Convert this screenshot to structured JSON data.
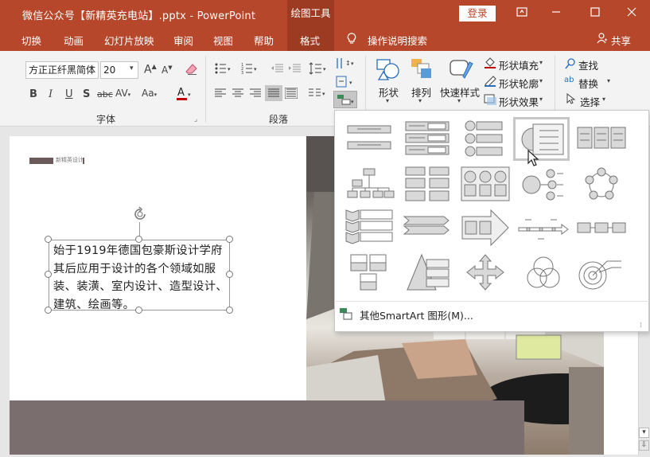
{
  "titlebar": {
    "document_title": "微信公众号【新精英充电站】.pptx  -  PowerPoint",
    "contextual_tab": "绘图工具",
    "login_label": "登录",
    "colors": {
      "accent": "#b7472a",
      "accent_dark": "#9c3b22"
    }
  },
  "tabs": [
    {
      "label": "切换"
    },
    {
      "label": "动画"
    },
    {
      "label": "幻灯片放映"
    },
    {
      "label": "审阅"
    },
    {
      "label": "视图"
    },
    {
      "label": "帮助"
    },
    {
      "label": "格式"
    }
  ],
  "tell_me": "操作说明搜索",
  "share_label": "共享",
  "ribbon": {
    "font_group_label": "字体",
    "paragraph_group_label": "段落",
    "font_name": "方正正纤黑简体",
    "font_size": "20",
    "shape_label": "形状",
    "arrange_label": "排列",
    "quick_style_label": "快速样式",
    "shape_fill": "形状填充",
    "shape_outline": "形状轮廓",
    "shape_effects": "形状效果",
    "find": "查找",
    "replace": "替换",
    "select": "选择"
  },
  "slide": {
    "logo_text": "新精英设计",
    "body_text": "始于1919年德国包豪斯设计学府其后应用于设计的各个领域如服装、装潢、室内设计、造型设计、建筑、绘画等。"
  },
  "smartart_menu": {
    "more_label": "其他SmartArt 图形(M)...",
    "selected_index": 3
  }
}
